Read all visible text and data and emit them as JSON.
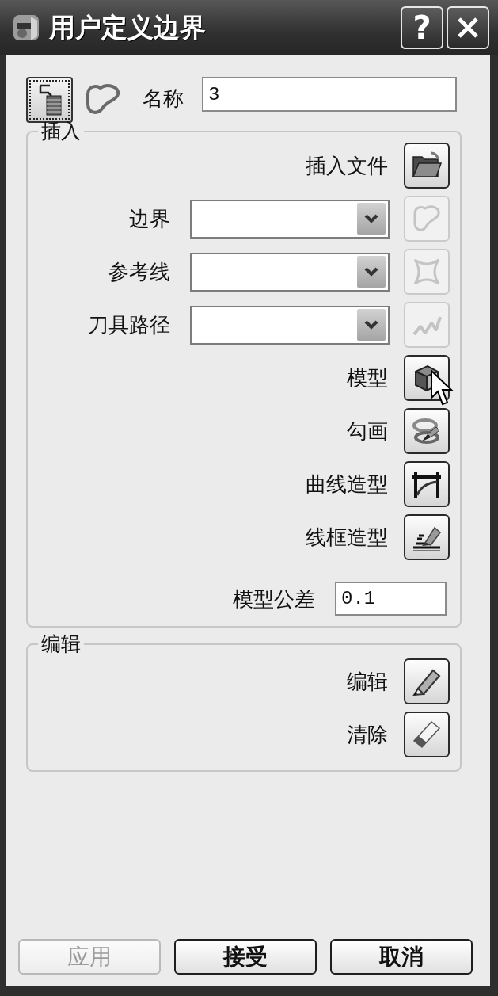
{
  "window": {
    "title": "用户定义边界",
    "help_button": "?"
  },
  "header": {
    "modes": [
      {
        "selected": true
      },
      {
        "selected": false
      }
    ],
    "name_label": "名称",
    "name_value": "3"
  },
  "insert": {
    "title": "插入",
    "rows": [
      {
        "kind": "button",
        "label": "插入文件",
        "disabled": false,
        "hovered": false
      },
      {
        "kind": "dropdown",
        "label": "边界",
        "disabled": true,
        "hovered": false
      },
      {
        "kind": "dropdown",
        "label": "参考线",
        "disabled": true,
        "hovered": false
      },
      {
        "kind": "dropdown",
        "label": "刀具路径",
        "disabled": true,
        "hovered": false
      },
      {
        "kind": "button",
        "label": "模型",
        "disabled": false,
        "hovered": true
      },
      {
        "kind": "button",
        "label": "勾画",
        "disabled": false,
        "hovered": false
      },
      {
        "kind": "button",
        "label": "曲线造型",
        "disabled": false,
        "hovered": false
      },
      {
        "kind": "button",
        "label": "线框造型",
        "disabled": false,
        "hovered": false
      },
      {
        "kind": "field",
        "label": "模型公差",
        "value": "0.1",
        "disabled": false,
        "hovered": false
      }
    ]
  },
  "edit": {
    "title": "编辑",
    "rows": [
      {
        "kind": "button",
        "label": "编辑",
        "disabled": false,
        "hovered": false
      },
      {
        "kind": "button",
        "label": "清除",
        "disabled": false,
        "hovered": false
      }
    ]
  },
  "footer": {
    "buttons": [
      {
        "label": "应用",
        "disabled": true
      },
      {
        "label": "接受",
        "disabled": false
      },
      {
        "label": "取消",
        "disabled": false
      }
    ]
  }
}
